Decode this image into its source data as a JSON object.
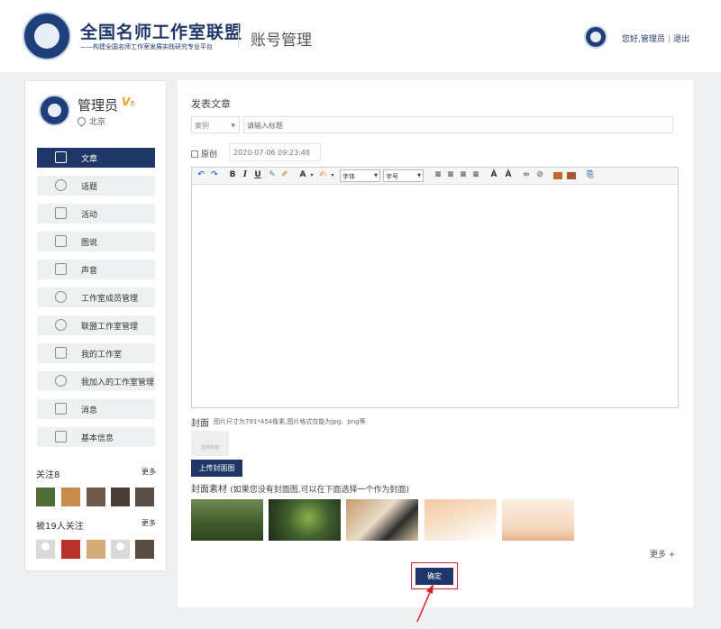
{
  "header": {
    "logo_title": "全国名师工作室联盟",
    "logo_subtitle": "——构建全国名师工作室发展实践研究专业平台",
    "page_title": "账号管理",
    "greeting": "您好,",
    "username": "管理员",
    "separator": "|",
    "logout": "退出"
  },
  "profile": {
    "name": "管理员",
    "vip": "V₅",
    "location": "北京"
  },
  "menu": [
    {
      "label": "文章",
      "icon": "article-icon",
      "active": true
    },
    {
      "label": "话题",
      "icon": "chat-bubble-icon"
    },
    {
      "label": "活动",
      "icon": "flag-icon"
    },
    {
      "label": "图说",
      "icon": "image-icon"
    },
    {
      "label": "声音",
      "icon": "audio-icon"
    },
    {
      "label": "工作室成员管理",
      "icon": "user-icon"
    },
    {
      "label": "联盟工作室管理",
      "icon": "shield-icon"
    },
    {
      "label": "我的工作室",
      "icon": "home-icon"
    },
    {
      "label": "我加入的工作室管理",
      "icon": "user-add-icon"
    },
    {
      "label": "消息",
      "icon": "mail-icon"
    },
    {
      "label": "基本信息",
      "icon": "id-card-icon"
    }
  ],
  "following": {
    "title": "关注8",
    "more": "更多"
  },
  "followers": {
    "title": "被19人关注",
    "more": "更多"
  },
  "main": {
    "section_title": "发表文章",
    "category": "案例",
    "title_placeholder": "请输入标题",
    "original_label": "原创",
    "date": "2020-07-06 09:23:48",
    "toolbar": {
      "font_family": "字体",
      "font_size": "字号",
      "bold": "B",
      "italic": "I",
      "underline": "U",
      "font_color": "A"
    },
    "cover_label": "封面",
    "cover_hint": "图片尺寸为791*454像素,图片格式仅能为jpg、png等",
    "cover_placeholder": "选择封面",
    "upload_label": "上传封面图",
    "materials_title": "封面素材",
    "materials_note": "(如果您没有封面图,可以在下面选择一个作为封面)",
    "more": "更多 +",
    "confirm": "确定"
  },
  "colors": {
    "brand": "#1f3768",
    "highlight": "#d8202a"
  }
}
